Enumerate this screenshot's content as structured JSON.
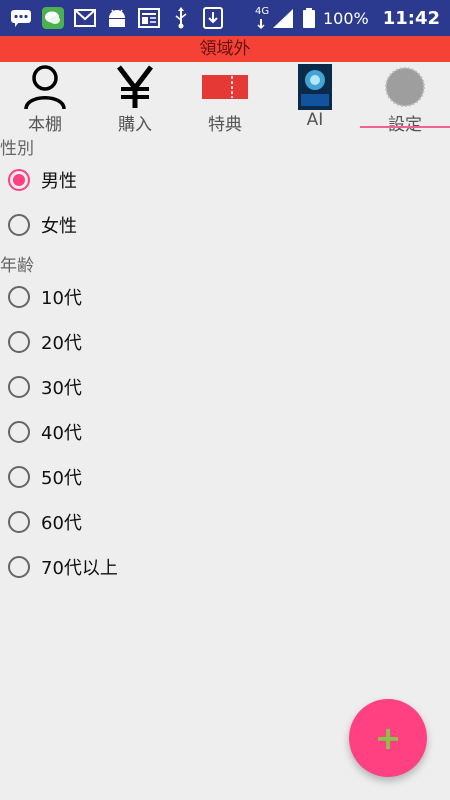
{
  "status_bar": {
    "icons": [
      "chat-icon",
      "wechat-icon",
      "mail-icon",
      "android-icon",
      "news-icon",
      "usb-icon",
      "download-icon"
    ],
    "network": "4G",
    "battery": "100%",
    "time": "11:42"
  },
  "banner": {
    "text": "領域外",
    "color": "#f44336"
  },
  "tabs": [
    {
      "label": "本棚",
      "icon": "person-icon"
    },
    {
      "label": "購入",
      "icon": "yen-icon"
    },
    {
      "label": "特典",
      "icon": "ticket-icon"
    },
    {
      "label": "AI",
      "icon": "ai-image-icon"
    },
    {
      "label": "設定",
      "icon": "gear-icon",
      "selected": true
    }
  ],
  "gender": {
    "label": "性別",
    "options": [
      "男性",
      "女性"
    ],
    "selected": "男性"
  },
  "age": {
    "label": "年齢",
    "options": [
      "10代",
      "20代",
      "30代",
      "40代",
      "50代",
      "60代",
      "70代以上"
    ],
    "selected": null
  },
  "fab": {
    "icon": "plus-icon",
    "label": "+"
  },
  "accent_color": "#ff4081"
}
